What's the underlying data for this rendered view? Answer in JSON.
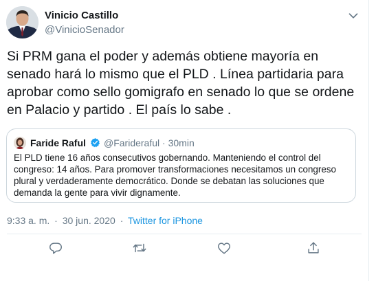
{
  "author": {
    "display_name": "Vinicio Castillo",
    "handle": "@VinicioSenador"
  },
  "tweet": {
    "text": "Si PRM gana el poder y además obtiene mayoría en senado hará lo mismo que el PLD . Línea partidaria para aprobar como sello gomigrafo en senado lo que se ordene en Palacio y partido . El país lo sabe ."
  },
  "quoted": {
    "display_name": "Faride Raful",
    "handle": "@Farideraful",
    "separator": "·",
    "time_ago": "30min",
    "text": "El PLD tiene 16 años consecutivos gobernando. Manteniendo el control del congreso: 14 años. Para promover transformaciones necesitamos un congreso plural y verdaderamente democrático. Donde se debatan las soluciones que demanda la gente para vivir dignamente."
  },
  "meta": {
    "time": "9:33 a. m.",
    "separator": "·",
    "date": "30 jun. 2020",
    "source": "Twitter for iPhone"
  },
  "icons": {
    "more": "chevron-down-icon",
    "verified": "verified-badge-icon",
    "reply": "reply-icon",
    "retweet": "retweet-icon",
    "like": "heart-icon",
    "share": "share-icon"
  },
  "colors": {
    "accent": "#1b95e0",
    "secondary_text": "#657786",
    "border": "#ccd6dd",
    "verified": "#1da1f2"
  }
}
